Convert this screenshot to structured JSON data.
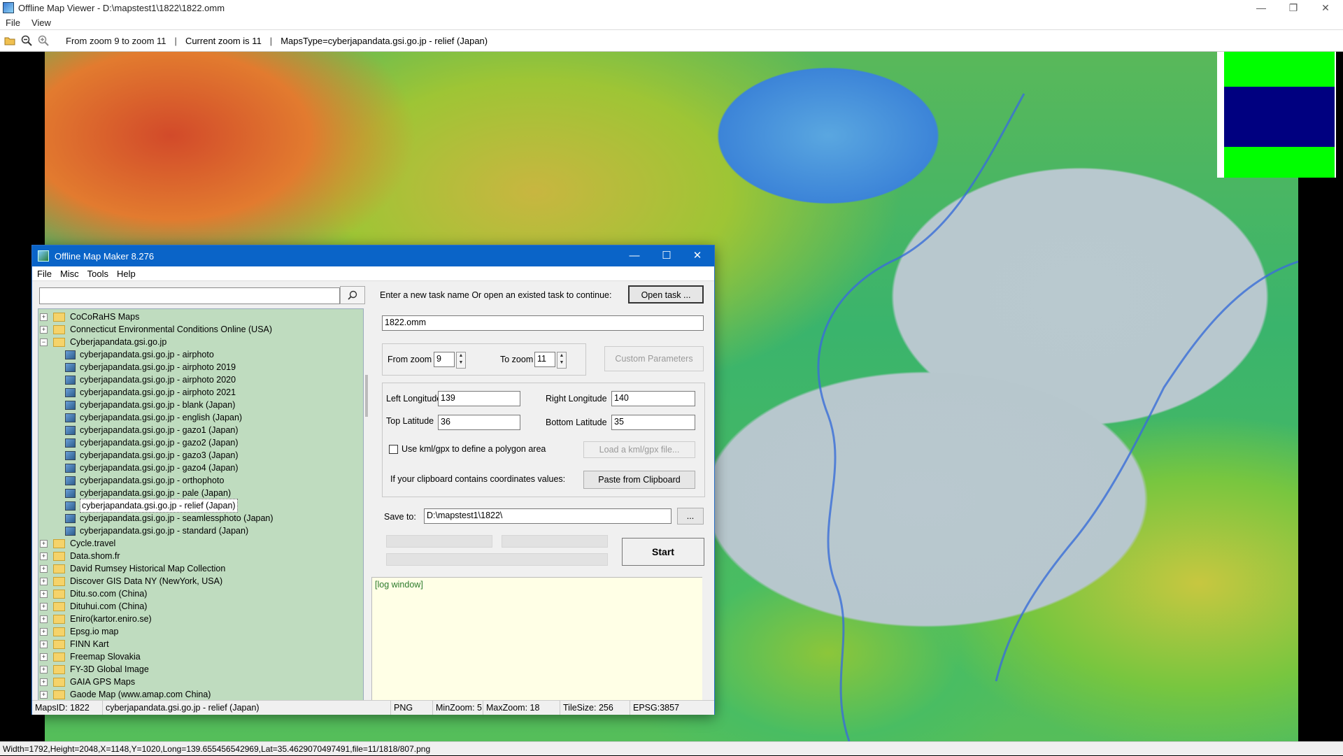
{
  "main_window": {
    "title": "Offline Map Viewer - D:\\mapstest1\\1822\\1822.omm",
    "controls": {
      "minimize": "—",
      "restore": "❐",
      "close": "✕"
    },
    "menu": [
      "File",
      "View"
    ],
    "toolbar": {
      "zoom_range_text": "From zoom 9 to zoom 11",
      "current_zoom_text": "Current zoom is 11",
      "maps_type_text": "MapsType=cyberjapandata.gsi.go.jp - relief (Japan)",
      "separator": "|"
    },
    "status_text": "Width=1792,Height=2048,X=1148,Y=1020,Long=139.655456542969,Lat=35.4629070497491,file=11/1818/807.png"
  },
  "dialog": {
    "title": "Offline Map Maker 8.276",
    "controls": {
      "minimize": "—",
      "maximize": "☐",
      "close": "✕"
    },
    "menu": [
      "File",
      "Misc",
      "Tools",
      "Help"
    ],
    "search": {
      "value": "",
      "placeholder": ""
    },
    "tree": [
      {
        "label": "CoCoRaHS Maps",
        "type": "folder",
        "level": 0,
        "expanded": false
      },
      {
        "label": "Connecticut Environmental Conditions Online (USA)",
        "type": "folder",
        "level": 0,
        "expanded": false
      },
      {
        "label": "Cyberjapandata.gsi.go.jp",
        "type": "folder",
        "level": 0,
        "expanded": true
      },
      {
        "label": "cyberjapandata.gsi.go.jp - airphoto",
        "type": "map",
        "level": 1
      },
      {
        "label": "cyberjapandata.gsi.go.jp - airphoto 2019",
        "type": "map",
        "level": 1
      },
      {
        "label": "cyberjapandata.gsi.go.jp - airphoto 2020",
        "type": "map",
        "level": 1
      },
      {
        "label": "cyberjapandata.gsi.go.jp - airphoto 2021",
        "type": "map",
        "level": 1
      },
      {
        "label": "cyberjapandata.gsi.go.jp - blank (Japan)",
        "type": "map",
        "level": 1
      },
      {
        "label": "cyberjapandata.gsi.go.jp - english (Japan)",
        "type": "map",
        "level": 1
      },
      {
        "label": "cyberjapandata.gsi.go.jp - gazo1 (Japan)",
        "type": "map",
        "level": 1
      },
      {
        "label": "cyberjapandata.gsi.go.jp - gazo2 (Japan)",
        "type": "map",
        "level": 1
      },
      {
        "label": "cyberjapandata.gsi.go.jp - gazo3 (Japan)",
        "type": "map",
        "level": 1
      },
      {
        "label": "cyberjapandata.gsi.go.jp - gazo4 (Japan)",
        "type": "map",
        "level": 1
      },
      {
        "label": "cyberjapandata.gsi.go.jp - orthophoto",
        "type": "map",
        "level": 1
      },
      {
        "label": "cyberjapandata.gsi.go.jp - pale (Japan)",
        "type": "map",
        "level": 1
      },
      {
        "label": "cyberjapandata.gsi.go.jp - relief (Japan)",
        "type": "map",
        "level": 1,
        "selected": true
      },
      {
        "label": "cyberjapandata.gsi.go.jp - seamlessphoto (Japan)",
        "type": "map",
        "level": 1
      },
      {
        "label": "cyberjapandata.gsi.go.jp - standard (Japan)",
        "type": "map",
        "level": 1
      },
      {
        "label": "Cycle.travel",
        "type": "folder",
        "level": 0,
        "expanded": false
      },
      {
        "label": "Data.shom.fr",
        "type": "folder",
        "level": 0,
        "expanded": false
      },
      {
        "label": "David Rumsey Historical Map Collection",
        "type": "folder",
        "level": 0,
        "expanded": false
      },
      {
        "label": "Discover GIS Data NY (NewYork, USA)",
        "type": "folder",
        "level": 0,
        "expanded": false
      },
      {
        "label": "Ditu.so.com (China)",
        "type": "folder",
        "level": 0,
        "expanded": false
      },
      {
        "label": "Dituhui.com (China)",
        "type": "folder",
        "level": 0,
        "expanded": false
      },
      {
        "label": "Eniro(kartor.eniro.se)",
        "type": "folder",
        "level": 0,
        "expanded": false
      },
      {
        "label": "Epsg.io map",
        "type": "folder",
        "level": 0,
        "expanded": false
      },
      {
        "label": "FINN Kart",
        "type": "folder",
        "level": 0,
        "expanded": false
      },
      {
        "label": "Freemap Slovakia",
        "type": "folder",
        "level": 0,
        "expanded": false
      },
      {
        "label": "FY-3D Global Image",
        "type": "folder",
        "level": 0,
        "expanded": false
      },
      {
        "label": "GAIA GPS Maps",
        "type": "folder",
        "level": 0,
        "expanded": false
      },
      {
        "label": "Gaode Map (www.amap.com China)",
        "type": "folder",
        "level": 0,
        "expanded": false
      }
    ],
    "task_prompt": "Enter a new task name Or open an existed task to continue:",
    "open_task_button": "Open task ...",
    "task_name": "1822.omm",
    "from_zoom_label": "From zoom",
    "from_zoom_value": "9",
    "to_zoom_label": "To zoom",
    "to_zoom_value": "11",
    "custom_params_button": "Custom Parameters",
    "left_longitude_label": "Left Longitude",
    "left_longitude_value": "139",
    "right_longitude_label": "Right Longitude",
    "right_longitude_value": "140",
    "top_latitude_label": "Top Latitude",
    "top_latitude_value": "36",
    "bottom_latitude_label": "Bottom Latitude",
    "bottom_latitude_value": "35",
    "kml_checkbox_label": "Use kml/gpx to define a polygon area",
    "kml_checked": false,
    "load_kml_button": "Load a kml/gpx file...",
    "clipboard_label": "If your clipboard contains coordinates values:",
    "paste_button": "Paste from Clipboard",
    "save_to_label": "Save to:",
    "save_to_value": "D:\\mapstest1\\1822\\",
    "browse_button": "...",
    "start_button": "Start",
    "log_text": "[log window]",
    "status": {
      "maps_id": "MapsID: 1822",
      "map_name": "cyberjapandata.gsi.go.jp - relief (Japan)",
      "format": "PNG",
      "min_zoom": "MinZoom: 5",
      "max_zoom": "MaxZoom: 18",
      "tile_size": "TileSize: 256",
      "epsg": "EPSG:3857"
    }
  },
  "colors": {
    "dialog_titlebar": "#0a64c8",
    "tree_background": "#bfdcbf",
    "log_background": "#ffffe6",
    "legend_green": "#00ff00",
    "legend_navy": "#000080"
  }
}
